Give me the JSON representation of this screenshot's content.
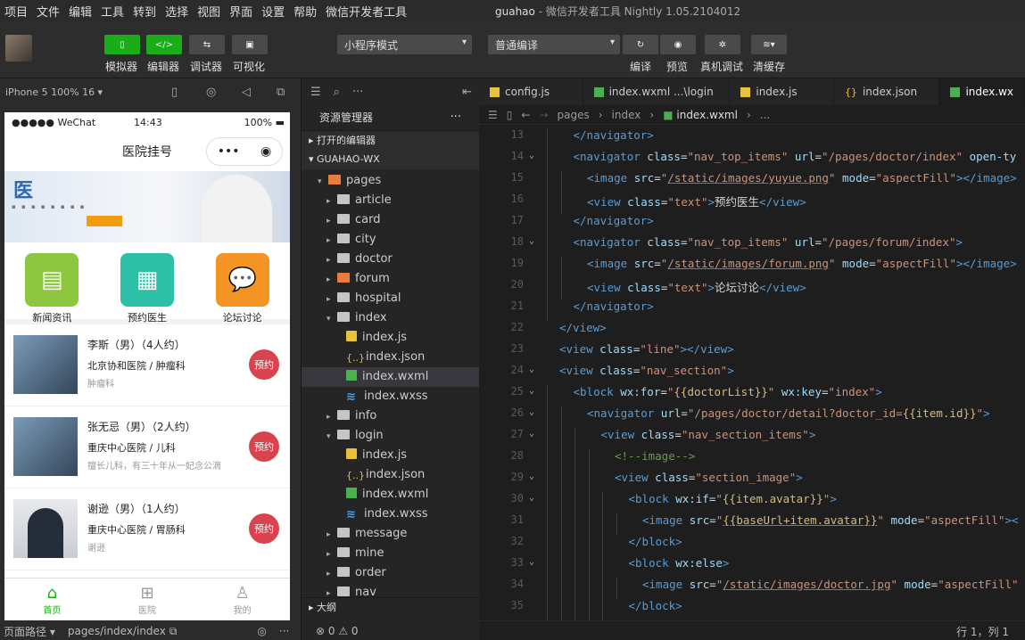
{
  "menu": [
    "项目",
    "文件",
    "编辑",
    "工具",
    "转到",
    "选择",
    "视图",
    "界面",
    "设置",
    "帮助",
    "微信开发者工具"
  ],
  "window_title": "guahao",
  "window_subtitle": " - 微信开发者工具 Nightly 1.05.2104012",
  "toolbar": {
    "simulator": "模拟器",
    "editor": "编辑器",
    "debugger": "调试器",
    "visual": "可视化",
    "mode": "小程序模式",
    "compile_mode": "普通编译",
    "compile": "编译",
    "preview": "预览",
    "remote_debug": "真机调试",
    "clear_cache": "清缓存"
  },
  "simulator": {
    "device": "iPhone 5 100% 16 ▾",
    "status_carrier": "●●●●● WeChat",
    "status_time": "14:43",
    "status_battery": "100%",
    "nav_title": "医院挂号",
    "banner_text": "医",
    "categories": [
      {
        "label": "新闻资讯",
        "color": "#8dc63f"
      },
      {
        "label": "预约医生",
        "color": "#2cc1a6"
      },
      {
        "label": "论坛讨论",
        "color": "#f39424"
      }
    ],
    "doctors": [
      {
        "name": "李斯（男）（4人约）",
        "hospital": "北京协和医院 / 肿瘤科",
        "desc": "肿瘤科",
        "btn": "预约"
      },
      {
        "name": "张无忌（男）（2人约）",
        "hospital": "重庆中心医院 / 儿科",
        "desc": "擅长儿科，有三十年从一妃念公滴",
        "btn": "预约"
      },
      {
        "name": "谢逊（男）（1人约）",
        "hospital": "重庆中心医院 / 胃肠科",
        "desc": "谢逊",
        "btn": "预约"
      }
    ],
    "tabs": [
      {
        "label": "首页",
        "active": true
      },
      {
        "label": "医院",
        "active": false
      },
      {
        "label": "我的",
        "active": false
      }
    ],
    "footer_path_label": "页面路径 ▾",
    "footer_path": "pages/index/index"
  },
  "explorer": {
    "title": "资源管理器",
    "open_editors": "打开的编辑器",
    "project": "GUAHAO-WX",
    "outline": "大纲",
    "problems": "⊗ 0 ⚠ 0",
    "tree": [
      {
        "label": "pages",
        "depth": 1,
        "type": "folder-open",
        "icon": "pg"
      },
      {
        "label": "article",
        "depth": 2,
        "type": "folder"
      },
      {
        "label": "card",
        "depth": 2,
        "type": "folder"
      },
      {
        "label": "city",
        "depth": 2,
        "type": "folder"
      },
      {
        "label": "doctor",
        "depth": 2,
        "type": "folder"
      },
      {
        "label": "forum",
        "depth": 2,
        "type": "folder",
        "icon": "pg"
      },
      {
        "label": "hospital",
        "depth": 2,
        "type": "folder"
      },
      {
        "label": "index",
        "depth": 2,
        "type": "folder-open"
      },
      {
        "label": "index.js",
        "depth": 3,
        "type": "js"
      },
      {
        "label": "index.json",
        "depth": 3,
        "type": "json"
      },
      {
        "label": "index.wxml",
        "depth": 3,
        "type": "wxml",
        "selected": true
      },
      {
        "label": "index.wxss",
        "depth": 3,
        "type": "wxss"
      },
      {
        "label": "info",
        "depth": 2,
        "type": "folder"
      },
      {
        "label": "login",
        "depth": 2,
        "type": "folder-open"
      },
      {
        "label": "index.js",
        "depth": 3,
        "type": "js"
      },
      {
        "label": "index.json",
        "depth": 3,
        "type": "json"
      },
      {
        "label": "index.wxml",
        "depth": 3,
        "type": "wxml"
      },
      {
        "label": "index.wxss",
        "depth": 3,
        "type": "wxss"
      },
      {
        "label": "message",
        "depth": 2,
        "type": "folder"
      },
      {
        "label": "mine",
        "depth": 2,
        "type": "folder"
      },
      {
        "label": "order",
        "depth": 2,
        "type": "folder"
      },
      {
        "label": "nav",
        "depth": 2,
        "type": "folder"
      }
    ]
  },
  "editor": {
    "tabs": [
      {
        "label": "config.js",
        "type": "js"
      },
      {
        "label": "index.wxml ...\\login",
        "type": "wxml"
      },
      {
        "label": "index.js",
        "type": "js"
      },
      {
        "label": "index.json",
        "type": "json"
      },
      {
        "label": "index.wx",
        "type": "wxml",
        "active": true
      }
    ],
    "breadcrumb": [
      "pages",
      "index",
      "index.wxml",
      "..."
    ],
    "status": "行 1，列 1",
    "lines": [
      {
        "n": "13",
        "fold": false,
        "indent": 1,
        "html": "<span class=\"t\">&lt;/navigator&gt;</span>"
      },
      {
        "n": "14",
        "fold": true,
        "indent": 1,
        "html": "<span class=\"t\">&lt;navigator</span> <span class=\"a\">class</span>=<span class=\"s\">\"nav_top_items\"</span> <span class=\"a\">url</span>=<span class=\"s\">\"/pages/doctor/index\"</span> <span class=\"a\">open-ty</span>"
      },
      {
        "n": "15",
        "fold": false,
        "indent": 2,
        "html": "<span class=\"t\">&lt;image</span> <span class=\"a\">src</span>=<span class=\"s\">\"<span class=\"u\">/static/images/yuyue.png</span>\"</span> <span class=\"a\">mode</span>=<span class=\"s\">\"aspectFill\"</span><span class=\"t\">&gt;&lt;/image&gt;</span>"
      },
      {
        "n": "16",
        "fold": false,
        "indent": 2,
        "html": "<span class=\"t\">&lt;view</span> <span class=\"a\">class</span>=<span class=\"s\">\"text\"</span><span class=\"t\">&gt;</span>预约医生<span class=\"t\">&lt;/view&gt;</span>"
      },
      {
        "n": "17",
        "fold": false,
        "indent": 1,
        "html": "<span class=\"t\">&lt;/navigator&gt;</span>"
      },
      {
        "n": "18",
        "fold": true,
        "indent": 1,
        "html": "<span class=\"t\">&lt;navigator</span> <span class=\"a\">class</span>=<span class=\"s\">\"nav_top_items\"</span> <span class=\"a\">url</span>=<span class=\"s\">\"/pages/forum/index\"</span><span class=\"t\">&gt;</span>"
      },
      {
        "n": "19",
        "fold": false,
        "indent": 2,
        "html": "<span class=\"t\">&lt;image</span> <span class=\"a\">src</span>=<span class=\"s\">\"<span class=\"u\">/static/images/forum.png</span>\"</span> <span class=\"a\">mode</span>=<span class=\"s\">\"aspectFill\"</span><span class=\"t\">&gt;&lt;/image&gt;</span>"
      },
      {
        "n": "20",
        "fold": false,
        "indent": 2,
        "html": "<span class=\"t\">&lt;view</span> <span class=\"a\">class</span>=<span class=\"s\">\"text\"</span><span class=\"t\">&gt;</span>论坛讨论<span class=\"t\">&lt;/view&gt;</span>"
      },
      {
        "n": "21",
        "fold": false,
        "indent": 1,
        "html": "<span class=\"t\">&lt;/navigator&gt;</span>"
      },
      {
        "n": "22",
        "fold": false,
        "indent": 0,
        "html": "<span class=\"t\">&lt;/view&gt;</span>"
      },
      {
        "n": "23",
        "fold": false,
        "indent": 0,
        "html": "<span class=\"t\">&lt;view</span> <span class=\"a\">class</span>=<span class=\"s\">\"line\"</span><span class=\"t\">&gt;&lt;/view&gt;</span>"
      },
      {
        "n": "24",
        "fold": true,
        "indent": 0,
        "html": "<span class=\"t\">&lt;view</span> <span class=\"a\">class</span>=<span class=\"s\">\"nav_section\"</span><span class=\"t\">&gt;</span>"
      },
      {
        "n": "25",
        "fold": true,
        "indent": 1,
        "html": "<span class=\"t\">&lt;block</span> <span class=\"a\">wx:for</span>=<span class=\"s\">\"<span class=\"c\">{{doctorList}}</span>\"</span> <span class=\"a\">wx:key</span>=<span class=\"s\">\"index\"</span><span class=\"t\">&gt;</span>"
      },
      {
        "n": "26",
        "fold": true,
        "indent": 2,
        "html": "<span class=\"t\">&lt;navigator</span> <span class=\"a\">url</span>=<span class=\"s\">\"/pages/doctor/detail?doctor_id=<span class=\"c\">{{item.id}}</span>\"</span><span class=\"t\">&gt;</span>"
      },
      {
        "n": "27",
        "fold": true,
        "indent": 3,
        "html": "<span class=\"t\">&lt;view</span> <span class=\"a\">class</span>=<span class=\"s\">\"nav_section_items\"</span><span class=\"t\">&gt;</span>"
      },
      {
        "n": "28",
        "fold": false,
        "indent": 4,
        "html": "<span class=\"m\">&lt;!--image--&gt;</span>"
      },
      {
        "n": "29",
        "fold": true,
        "indent": 4,
        "html": "<span class=\"t\">&lt;view</span> <span class=\"a\">class</span>=<span class=\"s\">\"section_image\"</span><span class=\"t\">&gt;</span>"
      },
      {
        "n": "30",
        "fold": true,
        "indent": 5,
        "html": "<span class=\"t\">&lt;block</span> <span class=\"a\">wx:if</span>=<span class=\"s\">\"<span class=\"c\">{{item.avatar}}</span>\"</span><span class=\"t\">&gt;</span>"
      },
      {
        "n": "31",
        "fold": false,
        "indent": 6,
        "html": "<span class=\"t\">&lt;image</span> <span class=\"a\">src</span>=<span class=\"s\">\"<span class=\"c u\">{{baseUrl+item.avatar}}</span>\"</span> <span class=\"a\">mode</span>=<span class=\"s\">\"aspectFill\"</span><span class=\"t\">&gt;&lt;</span>"
      },
      {
        "n": "32",
        "fold": false,
        "indent": 5,
        "html": "<span class=\"t\">&lt;/block&gt;</span>"
      },
      {
        "n": "33",
        "fold": true,
        "indent": 5,
        "html": "<span class=\"t\">&lt;block</span> <span class=\"a\">wx:else</span><span class=\"t\">&gt;</span>"
      },
      {
        "n": "34",
        "fold": false,
        "indent": 6,
        "html": "<span class=\"t\">&lt;image</span> <span class=\"a\">src</span>=<span class=\"s\">\"<span class=\"u\">/static/images/doctor.jpg</span>\"</span> <span class=\"a\">mode</span>=<span class=\"s\">\"aspectFill\"</span>"
      },
      {
        "n": "35",
        "fold": false,
        "indent": 5,
        "html": "<span class=\"t\">&lt;/block&gt;</span>"
      }
    ]
  }
}
